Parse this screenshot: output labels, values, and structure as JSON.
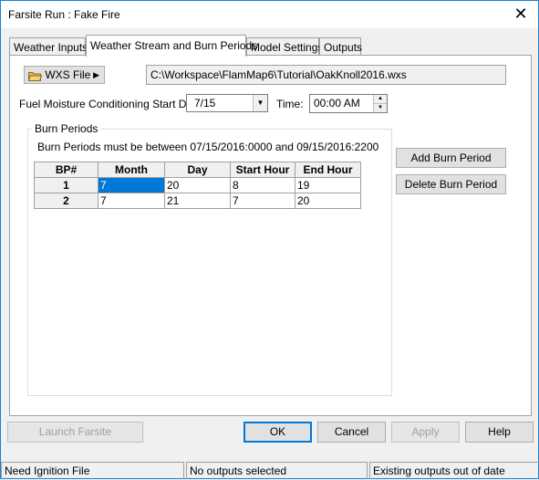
{
  "window": {
    "title": "Farsite Run : Fake Fire"
  },
  "tabs": [
    {
      "label": "Weather Inputs"
    },
    {
      "label": "Weather Stream and Burn Periods"
    },
    {
      "label": "Model Settings"
    },
    {
      "label": "Outputs"
    }
  ],
  "active_tab": "Weather Stream and Burn Periods",
  "wxs": {
    "button_label": "WXS File",
    "path": "C:\\Workspace\\FlamMap6\\Tutorial\\OakKnoll2016.wxs"
  },
  "conditioning": {
    "label": "Fuel Moisture Conditioning Start Day:",
    "start_day": "7/15",
    "time_label": "Time:",
    "time_value": "00:00 AM"
  },
  "burn_periods": {
    "group_title": "Burn Periods",
    "range_text": "Burn Periods must be between 07/15/2016:0000 and 09/15/2016:2200",
    "columns": [
      "BP#",
      "Month",
      "Day",
      "Start Hour",
      "End Hour"
    ],
    "rows": [
      {
        "bp": "1",
        "month": "7",
        "day": "20",
        "start": "8",
        "end": "19"
      },
      {
        "bp": "2",
        "month": "7",
        "day": "21",
        "start": "7",
        "end": "20"
      }
    ],
    "add_label": "Add Burn Period",
    "delete_label": "Delete Burn Period"
  },
  "footer": {
    "launch_label": "Launch Farsite",
    "ok_label": "OK",
    "cancel_label": "Cancel",
    "apply_label": "Apply",
    "help_label": "Help"
  },
  "status": [
    "Need Ignition File",
    "No outputs selected",
    "Existing outputs out of date"
  ],
  "colors": {
    "selection": "#0078d7",
    "window_border": "#1883d7",
    "folder_icon": "#e8b64a"
  }
}
